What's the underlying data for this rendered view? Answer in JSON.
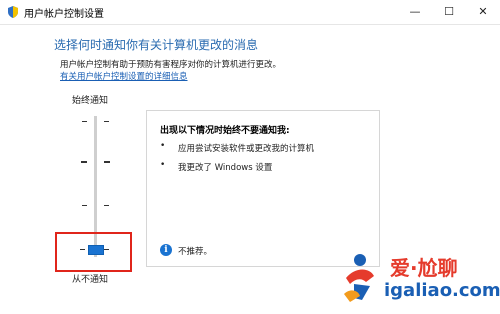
{
  "window": {
    "title": "用户帐户控制设置",
    "minimize_glyph": "—",
    "maximize_glyph": "☐",
    "close_glyph": "✕"
  },
  "main": {
    "title": "选择何时通知你有关计算机更改的消息",
    "description": "用户帐户控制有助于预防有害程序对你的计算机进行更改。",
    "link": "有关用户帐户控制设置的详细信息"
  },
  "slider": {
    "top_label": "始终通知",
    "bottom_label": "从不通知",
    "level_index": 3,
    "level_count": 4,
    "tick_glyph": "-"
  },
  "info": {
    "heading": "出现以下情况时始终不要通知我:",
    "bullets": [
      "应用尝试安装软件或更改我的计算机",
      "我更改了 Windows 设置"
    ],
    "bullet_glyph": "•",
    "icon_glyph": "i",
    "note": "不推荐。"
  },
  "watermark": {
    "text": "爱·尬聊",
    "subtext": "igaliao.com"
  },
  "colors": {
    "accent": "#1a73d1",
    "title_blue": "#2a6bb0",
    "highlight_red": "#e0251b",
    "watermark_red": "#e53b2c",
    "watermark_blue": "#1a5fb4"
  },
  "icons": {
    "app": "shield-icon",
    "info": "info-icon",
    "minimize": "minimize-icon",
    "maximize": "maximize-icon",
    "close": "close-icon"
  }
}
